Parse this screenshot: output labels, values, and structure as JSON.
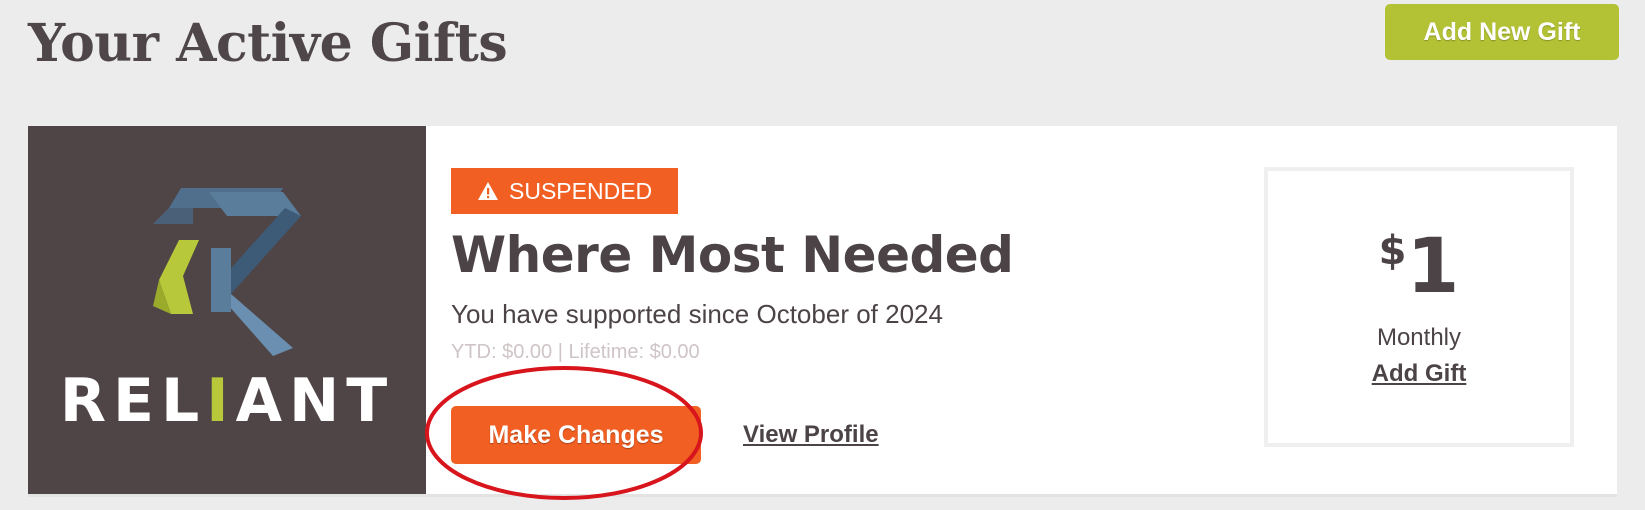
{
  "header": {
    "title": "Your Active Gifts",
    "add_new_gift_label": "Add New Gift"
  },
  "gift": {
    "organization_logo_text_before": "REL",
    "organization_logo_text_accent": "I",
    "organization_logo_text_after": "ANT",
    "status": "SUSPENDED",
    "status_icon": "warning-triangle-icon",
    "title": "Where Most Needed",
    "supported_since": "You have supported since October of 2024",
    "totals": "YTD: $0.00 | Lifetime: $0.00",
    "make_changes_label": "Make Changes",
    "view_profile_label": "View Profile",
    "amount_currency": "$",
    "amount_value": "1",
    "frequency": "Monthly",
    "add_gift_label": "Add Gift"
  },
  "colors": {
    "background": "#ececec",
    "accent_green": "#b3c234",
    "accent_orange": "#f15f22",
    "logo_panel": "#4f4546",
    "text_dark": "#4b4345",
    "annotation_red": "#d8141c"
  }
}
